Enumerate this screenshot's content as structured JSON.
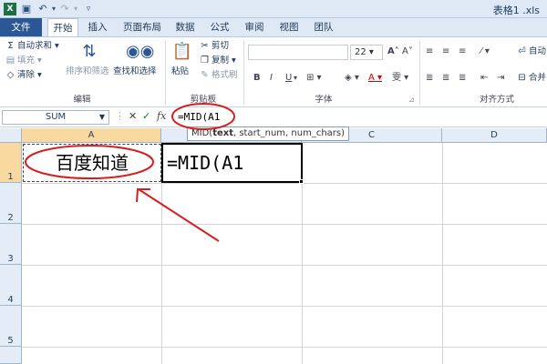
{
  "window": {
    "title": "表格1 .xls"
  },
  "tabs": [
    {
      "label": "文件"
    },
    {
      "label": "开始"
    },
    {
      "label": "插入"
    },
    {
      "label": "页面布局"
    },
    {
      "label": "数据"
    },
    {
      "label": "公式"
    },
    {
      "label": "审阅"
    },
    {
      "label": "视图"
    },
    {
      "label": "团队"
    }
  ],
  "ribbon": {
    "edit": {
      "label": "编辑",
      "autosum": "自动求和",
      "fill": "填充",
      "clear": "清除",
      "sort_filter": "排序和筛选",
      "find_select": "查找和选择"
    },
    "clipboard": {
      "label": "剪贴板",
      "paste": "粘贴",
      "cut": "剪切",
      "copy": "复制",
      "format_painter": "格式刷"
    },
    "font": {
      "label": "字体",
      "font_name": "",
      "font_size": "22",
      "bold": "B",
      "italic": "I",
      "underline": "U",
      "grow": "A",
      "shrink": "A",
      "font_color": "A",
      "phonetic": "雯"
    },
    "alignment": {
      "label": "对齐方式",
      "wrap": "自动",
      "merge": "合并"
    }
  },
  "formula_bar": {
    "name_box": "SUM",
    "cancel": "✕",
    "enter": "✓",
    "fx": "fx",
    "content": "=MID(A1"
  },
  "tooltip": {
    "func": "MID(",
    "arg_bold": "text",
    "rest": ", start_num, num_chars)"
  },
  "sheet": {
    "columns": [
      "A",
      "B",
      "C",
      "D"
    ],
    "rows": [
      "1",
      "2",
      "3",
      "4",
      "5"
    ],
    "cells": {
      "A1": "百度知道",
      "B1": "=MID(A1"
    }
  },
  "colors": {
    "file_tab": "#2b5797",
    "annotation": "#d81e1e",
    "selected_header": "#f9d99f"
  }
}
